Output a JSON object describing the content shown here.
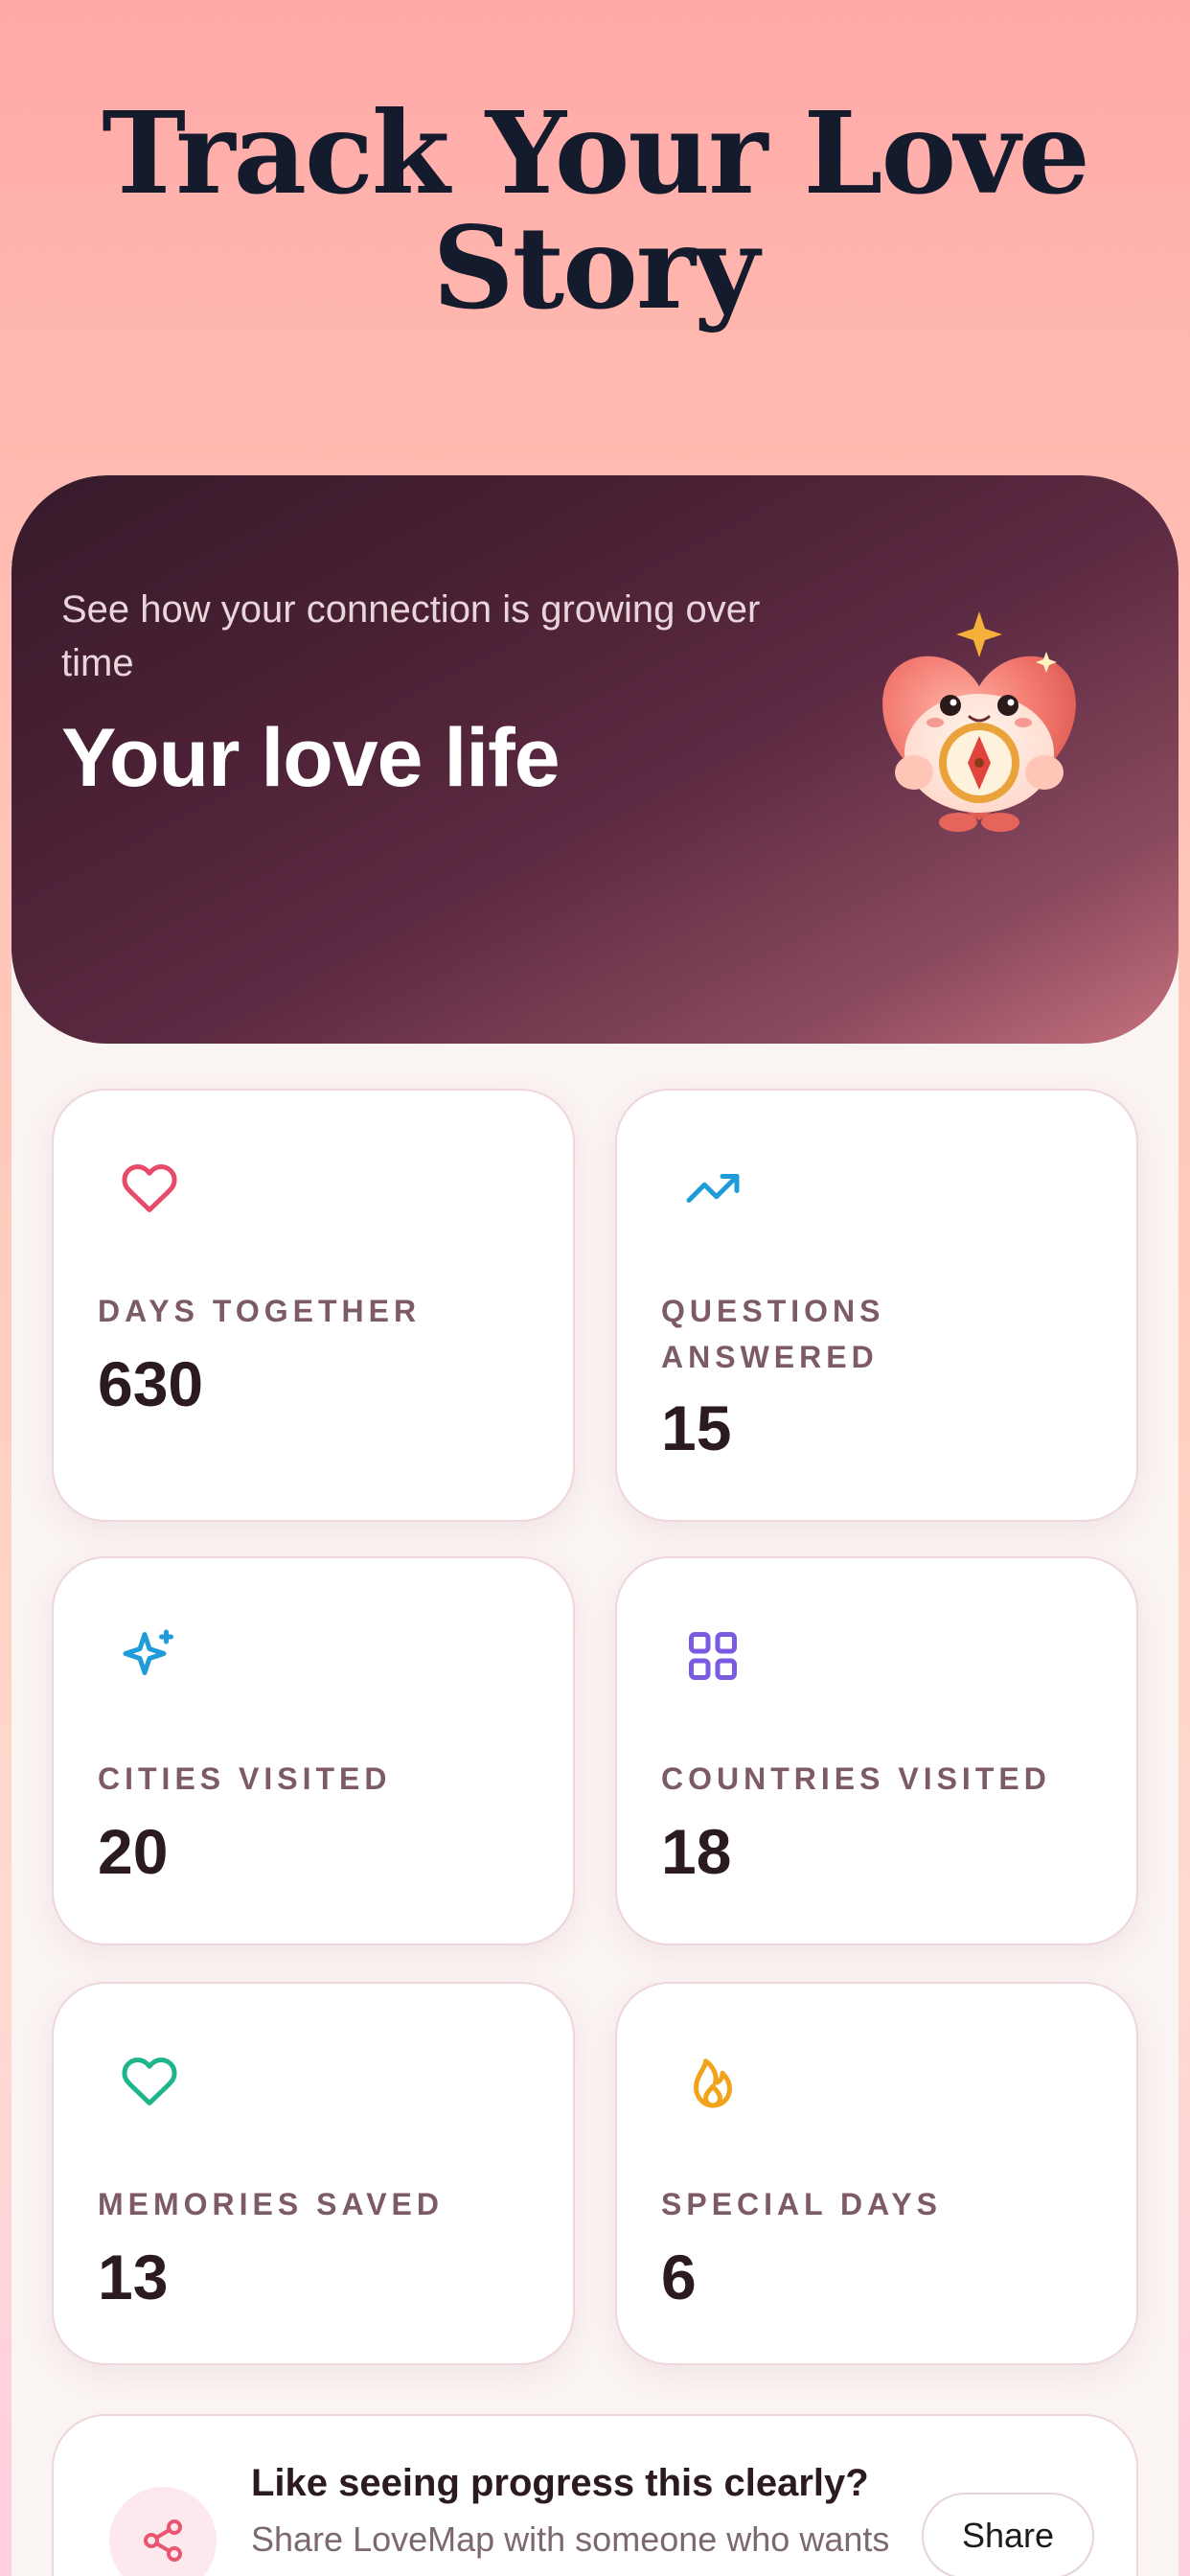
{
  "headline": {
    "line1": "Track Your Love",
    "line2": "Story"
  },
  "hero": {
    "subtitle": "See how your connection is growing over time",
    "title": "Your love life",
    "mascot_icon": "heart-compass-mascot"
  },
  "stats": [
    {
      "label": "DAYS TOGETHER",
      "value": "630",
      "icon": "heart-outline-icon",
      "color": "#e84a6a"
    },
    {
      "label": "QUESTIONS ANSWERED",
      "value": "15",
      "icon": "trending-up-icon",
      "color": "#1e9bd8"
    },
    {
      "label": "CITIES VISITED",
      "value": "20",
      "icon": "sparkle-icon",
      "color": "#1e9bd8"
    },
    {
      "label": "COUNTRIES VISITED",
      "value": "18",
      "icon": "grid-icon",
      "color": "#7a5ae0"
    },
    {
      "label": "MEMORIES SAVED",
      "value": "13",
      "icon": "heart-outline-icon",
      "color": "#1fb58a"
    },
    {
      "label": "SPECIAL DAYS",
      "value": "6",
      "icon": "flame-icon",
      "color": "#f2a31c"
    }
  ],
  "promo": {
    "title": "Like seeing progress this clearly?",
    "text": "Share LoveMap with someone who wants",
    "button": "Share",
    "icon": "share-icon",
    "accent": "#e8576f"
  }
}
